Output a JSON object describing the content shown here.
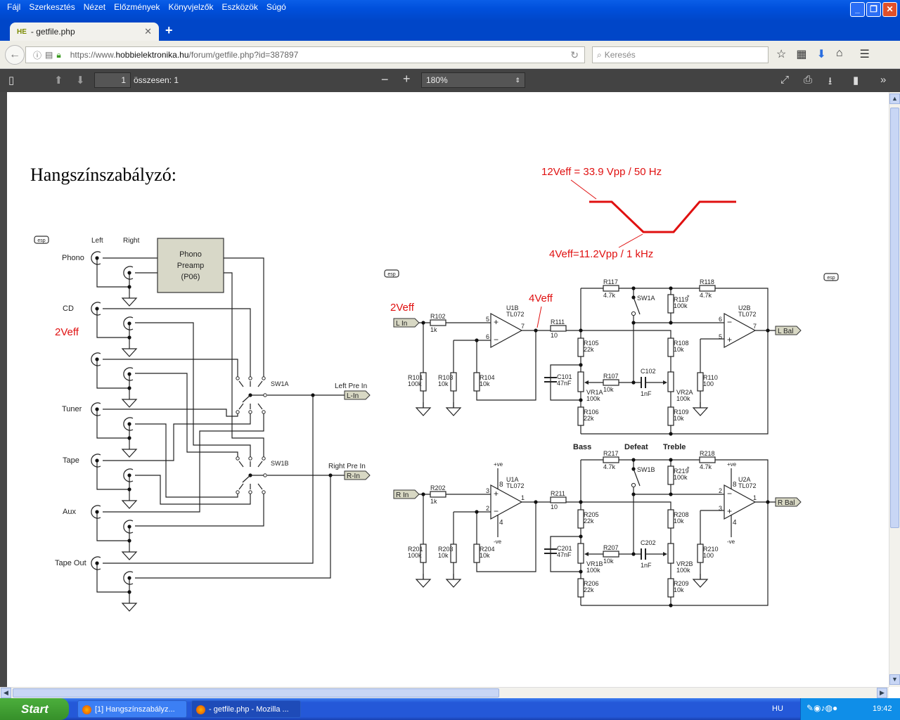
{
  "window": {
    "menu": [
      "Fájl",
      "Szerkesztés",
      "Nézet",
      "Előzmények",
      "Könyvjelzők",
      "Eszközök",
      "Súgó"
    ]
  },
  "tab": {
    "favicon": "HE",
    "title": "- getfile.php"
  },
  "navbar": {
    "url_prefix": "https://www.",
    "url_domain": "hobbielektronika.hu",
    "url_path": "/forum/getfile.php?id=387897",
    "search_placeholder": "Keresés"
  },
  "pdf_toolbar": {
    "page": "1",
    "total": "összesen: 1",
    "zoom": "180%"
  },
  "document": {
    "title": "Hangszínszabályzó:",
    "annotations": {
      "top_level": "12Veff = 33.9 Vpp / 50 Hz",
      "mid_level": "4Veff=11.2Vpp / 1 kHz",
      "in_level": "2Veff",
      "after_buffer": "4Veff",
      "source_level": "2Veff"
    },
    "annotation_color": "#e01010",
    "selector": {
      "logo": "esp",
      "col_left": "Left",
      "col_right": "Right",
      "inputs": [
        "Phono",
        "CD",
        "",
        "Tuner",
        "Tape",
        "Aux",
        "Tape Out"
      ],
      "preamp": [
        "Phono",
        "Preamp",
        "(P06)"
      ],
      "sw_a": "SW1A",
      "sw_b": "SW1B",
      "left_out_label": "Left Pre In",
      "left_out_tag": "L-In",
      "right_out_label": "Right Pre In",
      "right_out_tag": "R-In"
    },
    "tone": {
      "logo": "esp",
      "section_labels": [
        "Bass",
        "Defeat",
        "Treble"
      ],
      "blocks": [
        {
          "in_tag": "L In",
          "out_tag": "L Bal",
          "switch": "SW1A",
          "u1": [
            "U1B",
            "TL072"
          ],
          "u1_pins": [
            "5",
            "6",
            "7"
          ],
          "u2": [
            "U2B",
            "TL072"
          ],
          "u2_pins": [
            "6",
            "5",
            "7"
          ],
          "power": [],
          "parts": {
            "r1": [
              "R101",
              "100k"
            ],
            "r2": [
              "R102",
              "1k"
            ],
            "r3": [
              "R103",
              "10k"
            ],
            "r4": [
              "R104",
              "10k"
            ],
            "r11": [
              "R111",
              "10"
            ],
            "r5": [
              "R105",
              "22k"
            ],
            "c1": [
              "C101",
              "47nF"
            ],
            "vr1": [
              "VR1A",
              "100k"
            ],
            "r6": [
              "R106",
              "22k"
            ],
            "r7": [
              "R107",
              "10k"
            ],
            "c2": [
              "C102",
              "1nF"
            ],
            "r17": [
              "R117",
              "4.7k"
            ],
            "r19": [
              "R119",
              "100k"
            ],
            "r18": [
              "R118",
              "4.7k"
            ],
            "r8": [
              "R108",
              "10k"
            ],
            "vr2": [
              "VR2A",
              "100k"
            ],
            "r9": [
              "R109",
              "10k"
            ],
            "r10": [
              "R110",
              "100"
            ]
          }
        },
        {
          "in_tag": "R In",
          "out_tag": "R Bal",
          "switch": "SW1B",
          "u1": [
            "U1A",
            "TL072"
          ],
          "u1_pins": [
            "3",
            "2",
            "1"
          ],
          "u2": [
            "U2A",
            "TL072"
          ],
          "u2_pins": [
            "2",
            "3",
            "1"
          ],
          "power": [
            "+ve",
            "-ve",
            "8",
            "4"
          ],
          "parts": {
            "r1": [
              "R201",
              "100k"
            ],
            "r2": [
              "R202",
              "1k"
            ],
            "r3": [
              "R203",
              "10k"
            ],
            "r4": [
              "R204",
              "10k"
            ],
            "r11": [
              "R211",
              "10"
            ],
            "r5": [
              "R205",
              "22k"
            ],
            "c1": [
              "C201",
              "47nF"
            ],
            "vr1": [
              "VR1B",
              "100k"
            ],
            "r6": [
              "R206",
              "22k"
            ],
            "r7": [
              "R207",
              "10k"
            ],
            "c2": [
              "C202",
              "1nF"
            ],
            "r17": [
              "R217",
              "4.7k"
            ],
            "r19": [
              "R219",
              "100k"
            ],
            "r18": [
              "R218",
              "4.7k"
            ],
            "r8": [
              "R208",
              "10k"
            ],
            "vr2": [
              "VR2B",
              "100k"
            ],
            "r9": [
              "R209",
              "10k"
            ],
            "r10": [
              "R210",
              "100"
            ]
          }
        }
      ],
      "asterisk": "*"
    }
  },
  "taskbar": {
    "start": "Start",
    "tasks": [
      "[1] Hangszínszabályz...",
      "- getfile.php - Mozilla ..."
    ],
    "lang": "HU",
    "clock": "19:42"
  }
}
